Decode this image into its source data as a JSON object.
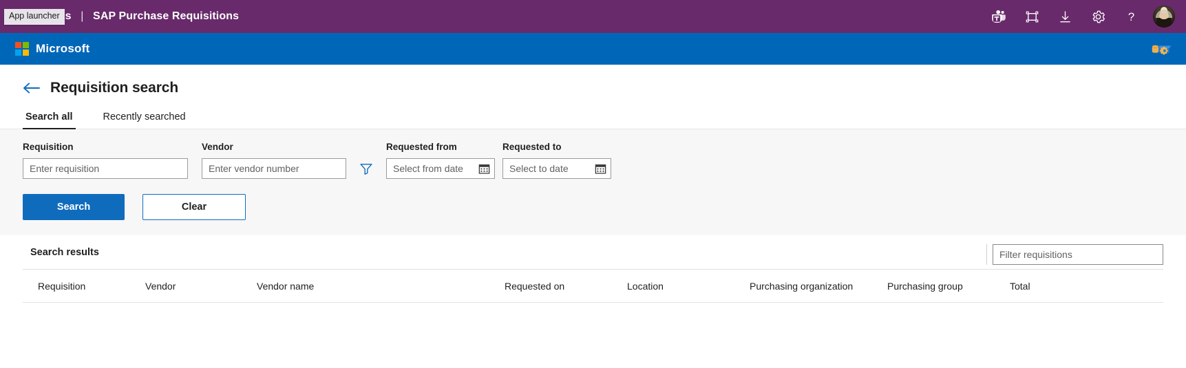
{
  "topbar": {
    "app_launcher_icon": "waffle-icon",
    "app_launcher_tooltip": "App launcher",
    "suite_name": "er Apps",
    "separator": "|",
    "app_title": "SAP Purchase Requisitions",
    "icons": [
      {
        "name": "teams-icon",
        "label": "Teams"
      },
      {
        "name": "fullscreen-icon",
        "label": "Full screen"
      },
      {
        "name": "download-icon",
        "label": "Download"
      },
      {
        "name": "gear-icon",
        "label": "Settings"
      },
      {
        "name": "help-icon",
        "label": "?"
      }
    ],
    "avatar_label": "Account manager",
    "background_color": "#682A6B"
  },
  "msbar": {
    "logo_name": "microsoft-logo",
    "wordmark": "Microsoft",
    "logo_colors": [
      "#F25022",
      "#7FBA00",
      "#00A4EF",
      "#FFB900"
    ],
    "background_color": "#0067B8",
    "right_icon": "data-settings-icon"
  },
  "page": {
    "back_icon": "back-arrow-icon",
    "title": "Requisition search",
    "tabs": [
      {
        "label": "Search all",
        "active": true
      },
      {
        "label": "Recently searched",
        "active": false
      }
    ]
  },
  "filters": {
    "requisition": {
      "label": "Requisition",
      "value": "",
      "placeholder": "Enter requisition"
    },
    "vendor": {
      "label": "Vendor",
      "value": "",
      "placeholder": "Enter vendor number"
    },
    "funnel_icon": "filter-funnel-icon",
    "requested_from": {
      "label": "Requested from",
      "value": "",
      "placeholder": "Select from date",
      "icon": "calendar-icon"
    },
    "requested_to": {
      "label": "Requested to",
      "value": "",
      "placeholder": "Select to date",
      "icon": "calendar-icon"
    },
    "search_button": "Search",
    "clear_button": "Clear",
    "primary_color": "#0F6CBD",
    "panel_background": "#F7F7F7"
  },
  "results": {
    "title": "Search results",
    "filter_input": {
      "value": "",
      "placeholder": "Filter requisitions"
    },
    "columns": [
      "Requisition",
      "Vendor",
      "Vendor name",
      "Requested on",
      "Location",
      "Purchasing organization",
      "Purchasing group",
      "Total"
    ],
    "rows": []
  }
}
